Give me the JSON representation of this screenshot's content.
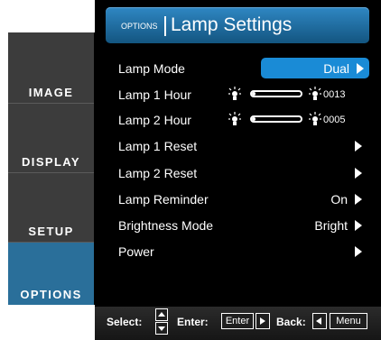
{
  "tabs": [
    {
      "label": "IMAGE"
    },
    {
      "label": "DISPLAY"
    },
    {
      "label": "SETUP"
    },
    {
      "label": "OPTIONS"
    }
  ],
  "header": {
    "small": "OPTIONS",
    "title": "Lamp Settings"
  },
  "rows": [
    {
      "label": "Lamp Mode",
      "value": "Dual"
    },
    {
      "label": "Lamp 1 Hour",
      "hours": "0013",
      "level": 0.05
    },
    {
      "label": "Lamp 2 Hour",
      "hours": "0005",
      "level": 0.03
    },
    {
      "label": "Lamp 1 Reset",
      "value": ""
    },
    {
      "label": "Lamp 2 Reset",
      "value": ""
    },
    {
      "label": "Lamp Reminder",
      "value": "On"
    },
    {
      "label": "Brightness Mode",
      "value": "Bright"
    },
    {
      "label": "Power",
      "value": ""
    }
  ],
  "footer": {
    "select": "Select:",
    "enter": "Enter:",
    "enter_key": "Enter",
    "back": "Back:",
    "menu_key": "Menu"
  },
  "colors": {
    "accent": "#1a8bd6",
    "active_tab": "#2a6f9a",
    "header_top": "#2f87c3"
  },
  "icons": [
    "lamp-icon",
    "right-arrow-icon",
    "up-down-icon"
  ]
}
